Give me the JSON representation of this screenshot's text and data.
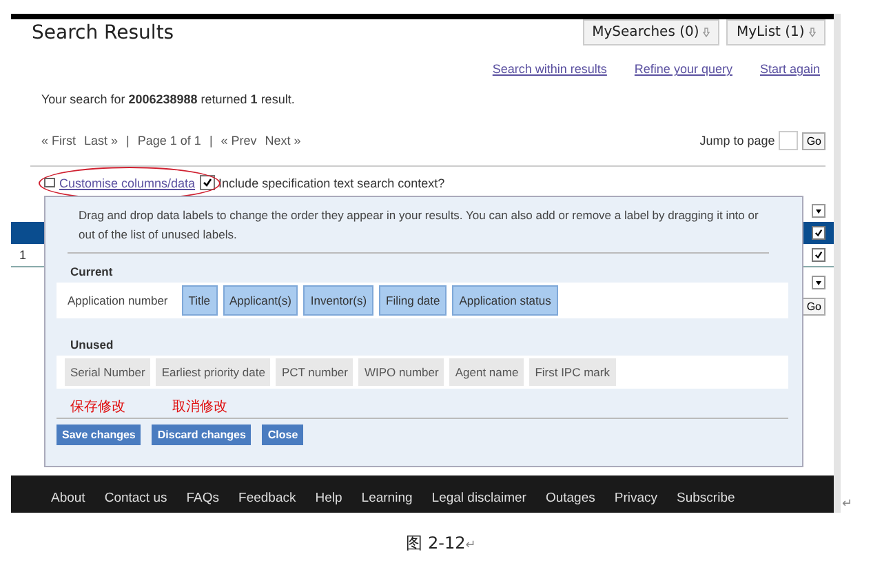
{
  "header": {
    "title": "Search Results",
    "buttons": [
      {
        "label": "MySearches (0)"
      },
      {
        "label": "MyList (1)"
      }
    ]
  },
  "links": [
    "Search within results",
    "Refine your query",
    "Start again"
  ],
  "summary": "Your search for **2006238988** returned **1** result.",
  "pager": {
    "items": [
      "« First",
      "Last »",
      "|",
      "Page 1 of 1",
      "|",
      "« Prev",
      "Next »"
    ],
    "jump_label": "Jump to page",
    "go": "Go"
  },
  "options": {
    "customise_link": "Customise columns/data",
    "include_context": {
      "label": "Include specification text search context?",
      "checked": true
    }
  },
  "results": {
    "header_checked": true,
    "row_number": "1",
    "row_checked": true,
    "go": "Go"
  },
  "popup": {
    "instructions": "Drag and drop data labels to change the order they appear in your results. You can also add or remove a label by dragging it into or out of the list of unused labels.",
    "current_label": "Current",
    "current": [
      {
        "label": "Application number",
        "kind": "fixed"
      },
      {
        "label": "Title",
        "kind": "label"
      },
      {
        "label": "Applicant(s)",
        "kind": "label"
      },
      {
        "label": "Inventor(s)",
        "kind": "label"
      },
      {
        "label": "Filing date",
        "kind": "label"
      },
      {
        "label": "Application status",
        "kind": "label"
      }
    ],
    "unused_label": "Unused",
    "unused": [
      "Serial Number",
      "Earliest priority date",
      "PCT number",
      "WIPO number",
      "Agent name",
      "First IPC mark"
    ],
    "notes": [
      "保存修改",
      "取消修改"
    ],
    "buttons": [
      "Save changes",
      "Discard changes",
      "Close"
    ]
  },
  "footer": [
    "About",
    "Contact us",
    "FAQs",
    "Feedback",
    "Help",
    "Learning",
    "Legal disclaimer",
    "Outages",
    "Privacy",
    "Subscribe"
  ],
  "footer_mark": "↵",
  "caption": {
    "text": "图 2-12",
    "mark": "↵"
  }
}
